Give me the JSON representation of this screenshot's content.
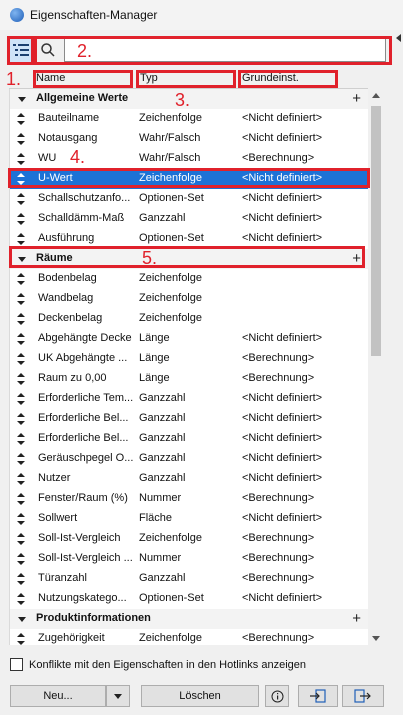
{
  "window": {
    "title": "Eigenschaften-Manager"
  },
  "toolbar": {
    "search_placeholder": ""
  },
  "columns": {
    "name": "Name",
    "type": "Typ",
    "default": "Grundeinst."
  },
  "groups": [
    {
      "name": "Allgemeine Werte",
      "rows": [
        {
          "name": "Bauteilname",
          "type": "Zeichenfolge",
          "default": "<Nicht definiert>"
        },
        {
          "name": "Notausgang",
          "type": "Wahr/Falsch",
          "default": "<Nicht definiert>"
        },
        {
          "name": "WU",
          "type": "Wahr/Falsch",
          "default": "<Berechnung>"
        },
        {
          "name": "U-Wert",
          "type": "Zeichenfolge",
          "default": "<Nicht definiert>"
        },
        {
          "name": "Schallschutzanfo...",
          "type": "Optionen-Set",
          "default": "<Nicht definiert>"
        },
        {
          "name": "Schalldämm-Maß",
          "type": "Ganzzahl",
          "default": "<Nicht definiert>"
        },
        {
          "name": "Ausführung",
          "type": "Optionen-Set",
          "default": "<Nicht definiert>"
        }
      ]
    },
    {
      "name": "Räume",
      "rows": [
        {
          "name": "Bodenbelag",
          "type": "Zeichenfolge",
          "default": ""
        },
        {
          "name": "Wandbelag",
          "type": "Zeichenfolge",
          "default": ""
        },
        {
          "name": "Deckenbelag",
          "type": "Zeichenfolge",
          "default": ""
        },
        {
          "name": "Abgehängte Decke",
          "type": "Länge",
          "default": "<Nicht definiert>"
        },
        {
          "name": "UK Abgehängte ...",
          "type": "Länge",
          "default": "<Berechnung>"
        },
        {
          "name": "Raum zu 0,00",
          "type": "Länge",
          "default": "<Berechnung>"
        },
        {
          "name": "Erforderliche Tem...",
          "type": "Ganzzahl",
          "default": "<Nicht definiert>"
        },
        {
          "name": "Erforderliche Bel...",
          "type": "Ganzzahl",
          "default": "<Nicht definiert>"
        },
        {
          "name": "Erforderliche Bel...",
          "type": "Ganzzahl",
          "default": "<Nicht definiert>"
        },
        {
          "name": "Geräuschpegel O...",
          "type": "Ganzzahl",
          "default": "<Nicht definiert>"
        },
        {
          "name": "Nutzer",
          "type": "Ganzzahl",
          "default": "<Nicht definiert>"
        },
        {
          "name": "Fenster/Raum (%)",
          "type": "Nummer",
          "default": "<Berechnung>"
        },
        {
          "name": "Sollwert",
          "type": "Fläche",
          "default": "<Nicht definiert>"
        },
        {
          "name": "Soll-Ist-Vergleich",
          "type": "Zeichenfolge",
          "default": "<Berechnung>"
        },
        {
          "name": "Soll-Ist-Vergleich ...",
          "type": "Nummer",
          "default": "<Berechnung>"
        },
        {
          "name": "Türanzahl",
          "type": "Ganzzahl",
          "default": "<Berechnung>"
        },
        {
          "name": "Nutzungskatego...",
          "type": "Optionen-Set",
          "default": "<Nicht definiert>"
        }
      ]
    },
    {
      "name": "Produktinformationen",
      "rows": [
        {
          "name": "Zugehörigkeit",
          "type": "Zeichenfolge",
          "default": "<Berechnung>"
        }
      ]
    }
  ],
  "annotations": [
    "1.",
    "2.",
    "3.",
    "4.",
    "5."
  ],
  "annotation_color": "#e0212b",
  "selection_color": "#1d72d6",
  "footer": {
    "conflict_label": "Konflikte mit den Eigenschaften in den Hotlinks anzeigen",
    "new_label": "Neu...",
    "delete_label": "Löschen"
  }
}
